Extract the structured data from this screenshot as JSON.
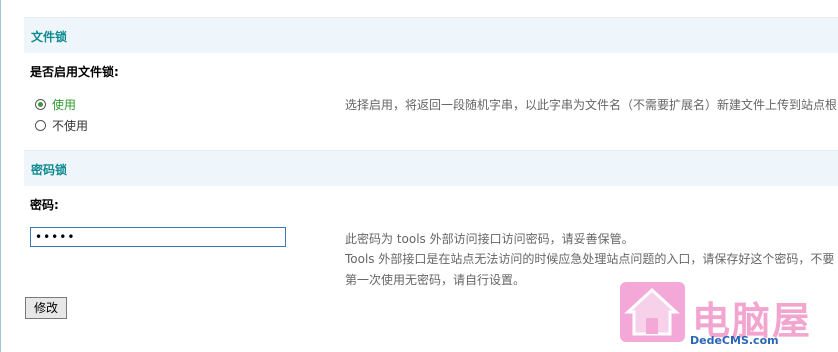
{
  "sections": {
    "file_lock": {
      "title": "文件锁",
      "label": "是否启用文件锁:",
      "options": [
        "使用",
        "不使用"
      ],
      "selected": "使用",
      "hint": "选择启用，将返回一段随机字串，以此字串为文件名（不需要扩展名）新建文件上传到站点根"
    },
    "password_lock": {
      "title": "密码锁",
      "label": "密码:",
      "value": "•••••",
      "hints": [
        "此密码为 tools 外部访问接口访问密码，请妥善保管。",
        "Tools 外部接口是在站点无法访问的时候应急处理站点问题的入口，请保存好这个密码，不要",
        "第一次使用无密码，请自行设置。"
      ]
    }
  },
  "actions": {
    "submit_label": "修改"
  },
  "watermark": {
    "title": "电脑屋",
    "url": "DedeCMS.com"
  },
  "colors": {
    "section_title": "#0f8a91",
    "section_bg": "#eff6fb",
    "selected_radio": "#2f9a2f",
    "input_border": "#3a78b4"
  }
}
